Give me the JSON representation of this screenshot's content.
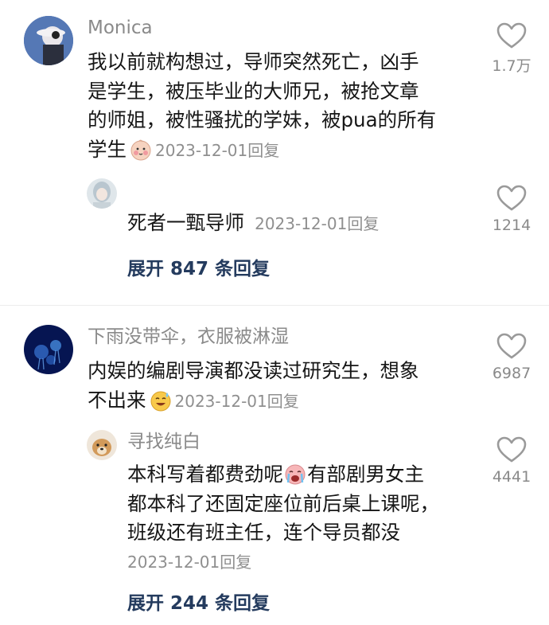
{
  "comments": [
    {
      "username": "Monica",
      "text_lines": [
        "我以前就构想过，导师突然死亡，凶手",
        "是学生，被压毕业的大师兄，被抢文章",
        "的师姐，被性骚扰的学妹，被pua的所有"
      ],
      "last_line": "学生",
      "emoji": "shy-face-emoji",
      "date": "2023-12-01",
      "reply_label": "回复",
      "likes": "1.7万",
      "reply": {
        "text": "死者一甄导师",
        "date": "2023-12-01",
        "reply_label": "回复",
        "likes": "1214"
      },
      "expand_label": "展开 847 条回复"
    },
    {
      "username": "下雨没带伞，衣服被淋湿",
      "text_lines": [
        "内娱的编剧导演都没读过研究生，想象"
      ],
      "last_line": "不出来",
      "emoji": "sweat-smile-emoji",
      "date": "2023-12-01",
      "reply_label": "回复",
      "likes": "6987",
      "reply": {
        "username": "寻找纯白",
        "line1_a": "本科写着都费劲呢",
        "line1_b": "有部剧男女主",
        "line2": "都本科了还固定座位前后桌上课呢，",
        "line3": "班级还有班主任，连个导员都没",
        "emoji": "crying-face-emoji",
        "date": "2023-12-01",
        "reply_label": "回复",
        "likes": "4441"
      },
      "expand_label": "展开 244 条回复"
    }
  ],
  "colors": {
    "username": "#8a8a8a",
    "text": "#161616",
    "meta": "#8f8f8f",
    "expand": "#243b5e",
    "heart": "#9a9a9a"
  }
}
